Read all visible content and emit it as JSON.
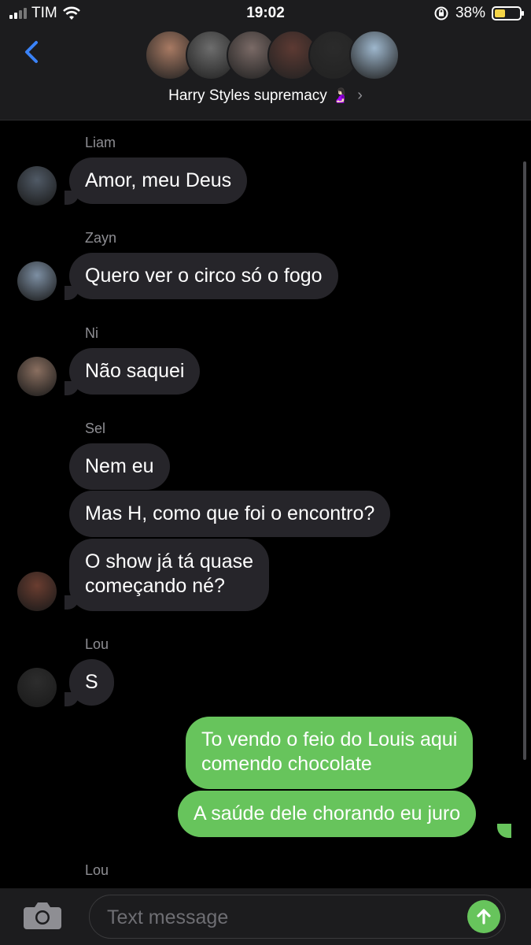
{
  "status_bar": {
    "carrier": "TIM",
    "time": "19:02",
    "battery": "38%"
  },
  "header": {
    "group_name": "Harry Styles supremacy",
    "group_emoji": "🤰🏻",
    "avatars": [
      "#a87a63",
      "#6d6d6d",
      "#7a6a66",
      "#5d3a33",
      "#2b2b2b",
      "#9eb7cd"
    ]
  },
  "messages": [
    {
      "sender": "Liam",
      "texts": [
        "Amor, meu Deus"
      ],
      "avatar_color": "#505a66"
    },
    {
      "sender": "Zayn",
      "texts": [
        "Quero ver o circo só o fogo"
      ],
      "avatar_color": "#7d8fa3"
    },
    {
      "sender": "Ni",
      "texts": [
        "Não saquei"
      ],
      "avatar_color": "#8a6f60"
    },
    {
      "sender": "Sel",
      "texts": [
        "Nem eu",
        "Mas H, como que foi o encontro?",
        "O show já tá quase",
        "começando né?"
      ],
      "avatar_color": "#6a3d30"
    },
    {
      "sender": "Lou",
      "texts": [
        "S"
      ],
      "avatar_color": "#2d2d2d"
    },
    {
      "sender": "me",
      "texts": [
        "To vendo o feio do Louis aqui",
        "comendo chocolate",
        "A saúde dele chorando eu juro"
      ]
    },
    {
      "sender": "Lou",
      "texts": []
    }
  ],
  "input": {
    "placeholder": "Text message"
  }
}
